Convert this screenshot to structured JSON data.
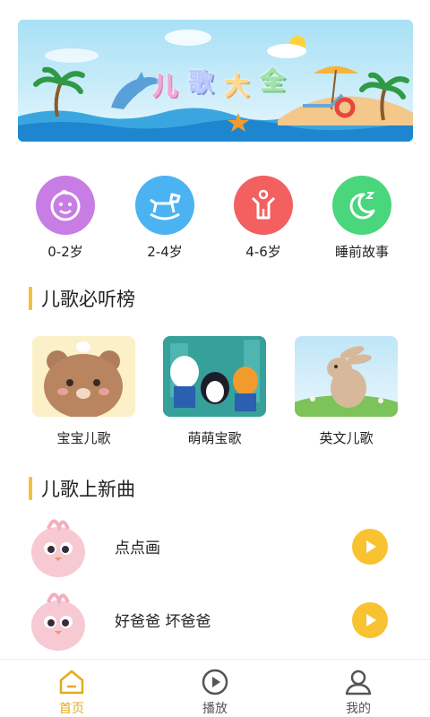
{
  "banner": {
    "title_chars": [
      "儿",
      "歌",
      "大",
      "全"
    ]
  },
  "categories": [
    {
      "label": "0-2岁",
      "color": "#c77de4",
      "icon": "baby-face-icon"
    },
    {
      "label": "2-4岁",
      "color": "#4bb3f2",
      "icon": "rocking-horse-icon"
    },
    {
      "label": "4-6岁",
      "color": "#f26060",
      "icon": "child-figure-icon"
    },
    {
      "label": "睡前故事",
      "color": "#49d67c",
      "icon": "moon-sleep-icon"
    }
  ],
  "must_listen": {
    "title": "儿歌必听榜",
    "cards": [
      {
        "label": "宝宝儿歌",
        "image": "teddy-bear-image"
      },
      {
        "label": "萌萌宝歌",
        "image": "octonauts-image"
      },
      {
        "label": "英文儿歌",
        "image": "bunny-image"
      }
    ]
  },
  "new_songs": {
    "title": "儿歌上新曲",
    "items": [
      {
        "title": "点点画"
      },
      {
        "title": "好爸爸 坏爸爸"
      }
    ]
  },
  "bottom_nav": {
    "items": [
      {
        "label": "首页",
        "icon": "home-icon",
        "active": true
      },
      {
        "label": "播放",
        "icon": "play-circle-icon",
        "active": false
      },
      {
        "label": "我的",
        "icon": "user-icon",
        "active": false
      }
    ]
  },
  "colors": {
    "accent": "#f5c13a",
    "active_nav": "#e2ac1c",
    "play_button": "#f8c230"
  }
}
